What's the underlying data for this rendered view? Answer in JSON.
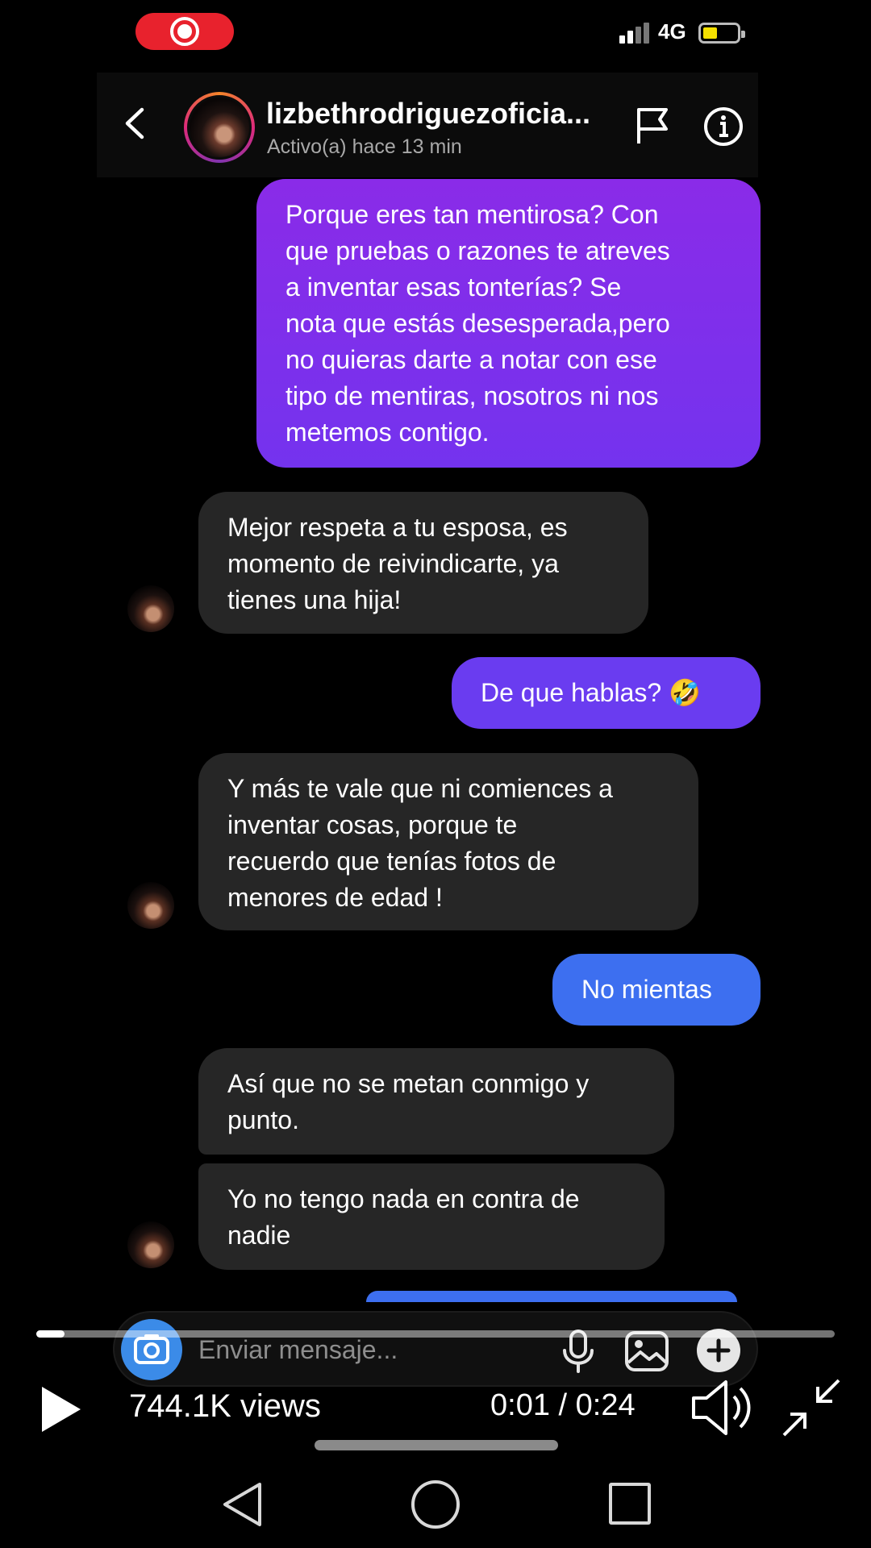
{
  "status_bar": {
    "network": "4G",
    "recording_icon": "screen-record-icon",
    "battery_color": "#f5e000"
  },
  "header": {
    "contact_name": "lizbethrodriguezoficia...",
    "contact_status": "Activo(a) hace 13 min",
    "icons": [
      "back-arrow-icon",
      "flag-icon",
      "info-icon"
    ]
  },
  "colors": {
    "sent_gradient_top": "#8a2be8",
    "sent_gradient_mid": "#6a3cf0",
    "sent_gradient_bottom": "#3d6ff0",
    "received_bubble": "#262626"
  },
  "messages": [
    {
      "direction": "sent",
      "lines": [
        "Porque eres tan mentirosa? Con",
        "que pruebas o razones te atreves",
        "a inventar esas tonterías? Se",
        "nota que estás desesperada,pero",
        "no quieras darte a notar con ese",
        "tipo de mentiras, nosotros ni nos",
        "metemos contigo."
      ]
    },
    {
      "direction": "received",
      "lines": [
        "Mejor respeta a tu esposa, es",
        "momento de reivindicarte, ya",
        "tienes una hija!"
      ]
    },
    {
      "direction": "sent",
      "lines": [
        "De que hablas? 🤣"
      ]
    },
    {
      "direction": "received",
      "lines": [
        "Y más te vale que ni comiences a",
        "inventar cosas, porque te",
        "recuerdo que tenías fotos de",
        "menores de edad !"
      ]
    },
    {
      "direction": "sent",
      "lines": [
        "No mientas"
      ]
    },
    {
      "direction": "received",
      "lines": [
        "Así que no se metan conmigo y",
        "punto."
      ]
    },
    {
      "direction": "received",
      "lines": [
        "Yo no tengo nada en contra de",
        "nadie"
      ]
    }
  ],
  "composer": {
    "placeholder": "Enviar mensaje...",
    "icons": [
      "camera-icon",
      "microphone-icon",
      "gallery-icon",
      "plus-icon"
    ]
  },
  "video": {
    "views": "744.1K views",
    "time": "0:01 / 0:24",
    "progress_fraction": 0.035,
    "icons": [
      "play-icon",
      "volume-icon",
      "exit-fullscreen-icon"
    ]
  },
  "navigation": {
    "icons": [
      "nav-back-icon",
      "nav-home-icon",
      "nav-recents-icon"
    ]
  }
}
